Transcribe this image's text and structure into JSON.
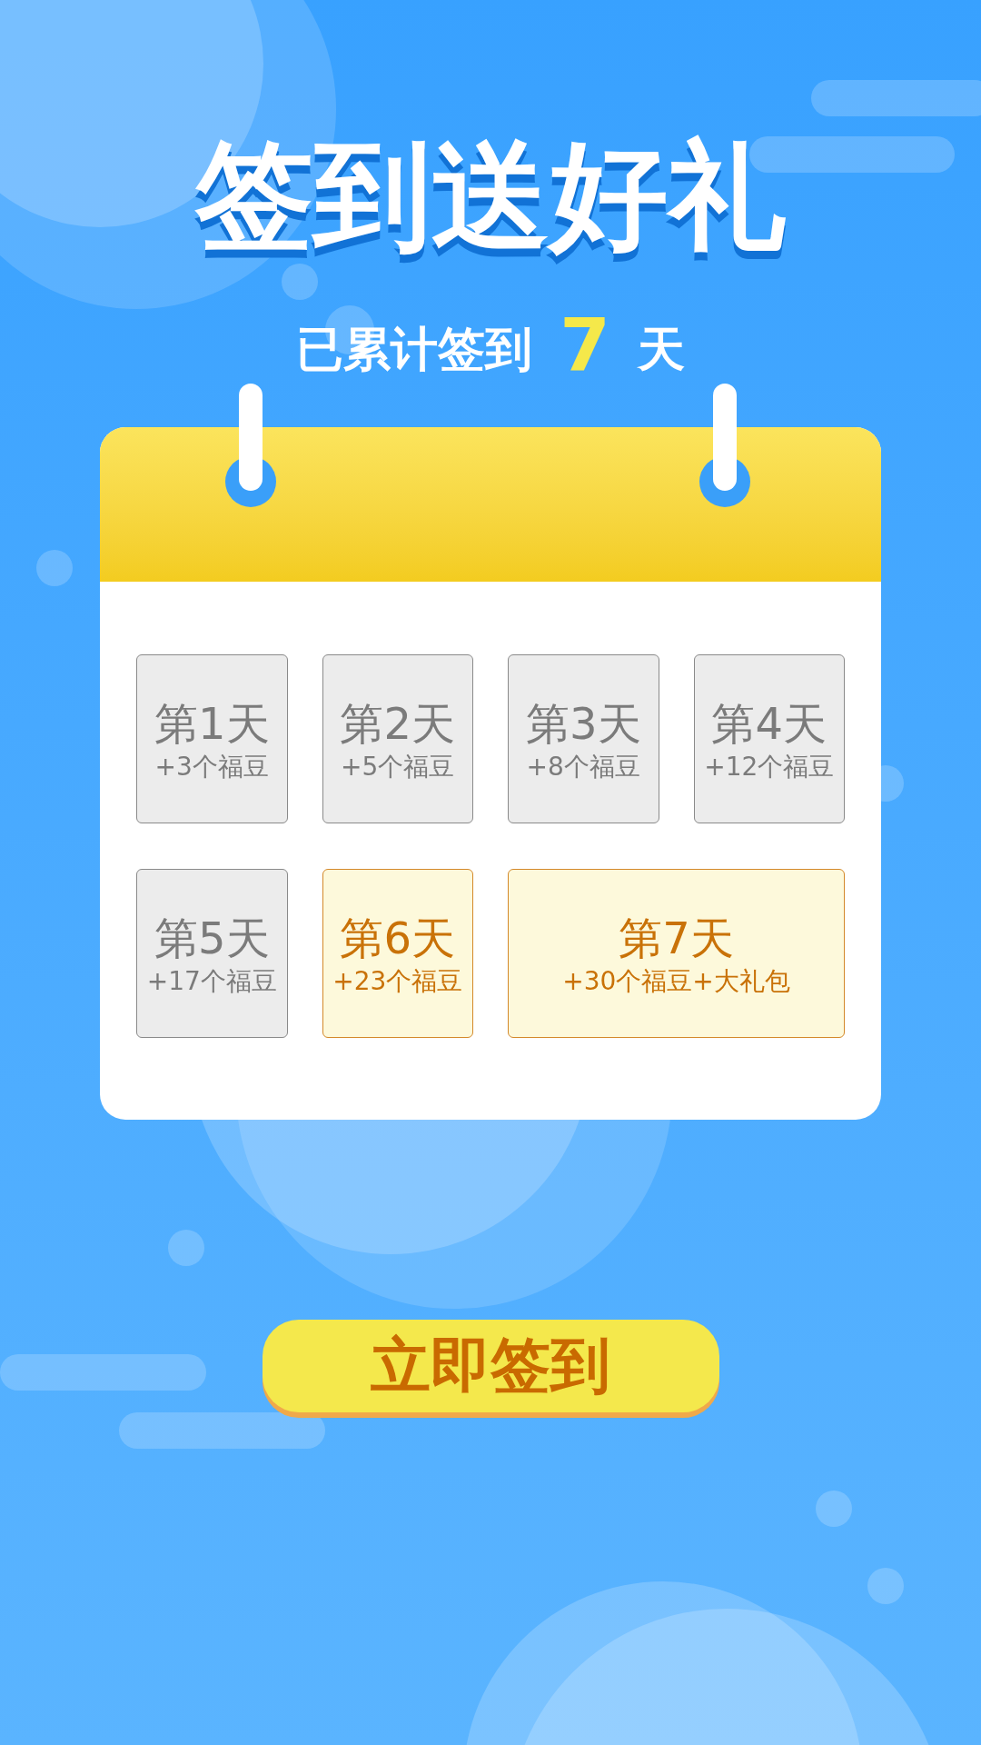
{
  "title": "签到送好礼",
  "summary": {
    "prefix": "已累计签到",
    "count": "7",
    "suffix": "天"
  },
  "days": [
    {
      "label": "第1天",
      "reward": "+3个福豆",
      "claimed": true,
      "wide": false
    },
    {
      "label": "第2天",
      "reward": "+5个福豆",
      "claimed": true,
      "wide": false
    },
    {
      "label": "第3天",
      "reward": "+8个福豆",
      "claimed": true,
      "wide": false
    },
    {
      "label": "第4天",
      "reward": "+12个福豆",
      "claimed": true,
      "wide": false
    },
    {
      "label": "第5天",
      "reward": "+17个福豆",
      "claimed": true,
      "wide": false
    },
    {
      "label": "第6天",
      "reward": "+23个福豆",
      "claimed": false,
      "wide": false
    },
    {
      "label": "第7天",
      "reward": "+30个福豆+大礼包",
      "claimed": false,
      "wide": true
    }
  ],
  "button": {
    "label": "立即签到"
  }
}
